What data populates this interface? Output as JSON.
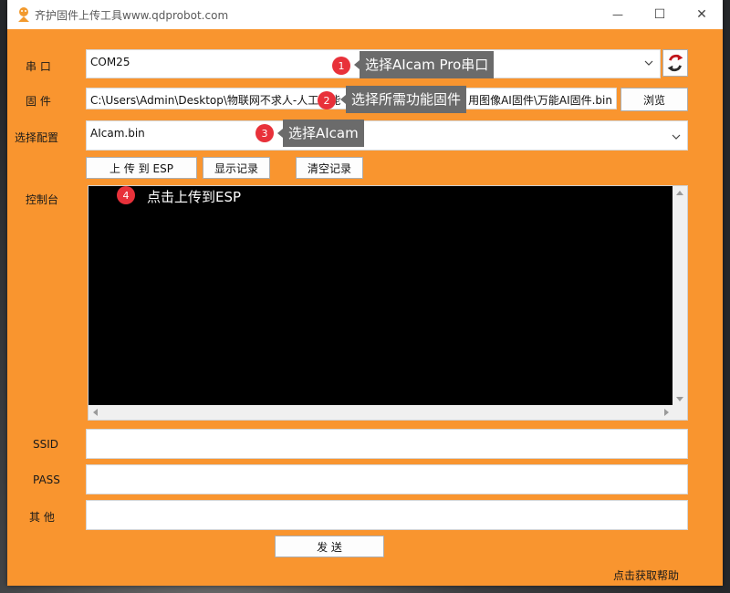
{
  "window": {
    "title": "齐护固件上传工具www.qdprobot.com",
    "controls": {
      "minimize": "—",
      "maximize": "☐",
      "close": "✕"
    },
    "accent_color": "#f9952f"
  },
  "form": {
    "port_label": "串  口",
    "port_value": "COM25",
    "firmware_label": "固  件",
    "firmware_path": "C:\\Users\\Admin\\Desktop\\物联网不求人-人工智能",
    "firmware_path_tail": "用图像AI固件\\万能AI固件.bin",
    "browse_label": "浏览",
    "config_label": "选择配置",
    "config_value": "AIcam.bin",
    "console_label": "控制台",
    "ssid_label": "SSID",
    "ssid_value": "",
    "pass_label": "PASS",
    "pass_value": "",
    "other_label": "其  他",
    "other_value": ""
  },
  "buttons": {
    "upload": "上 传 到 ESP",
    "show_log": "显示记录",
    "clear_log": "清空记录",
    "send": "发    送"
  },
  "help_text": "点击获取帮助",
  "annotations": [
    {
      "number": "1",
      "text": "选择AIcam Pro串口"
    },
    {
      "number": "2",
      "text": "选择所需功能固件"
    },
    {
      "number": "3",
      "text": "选择AIcam"
    },
    {
      "number": "4",
      "text": "点击上传到ESP"
    }
  ],
  "icons": {
    "refresh": "refresh-icon",
    "dropdown": "chevron-down-icon",
    "app": "app-icon"
  }
}
